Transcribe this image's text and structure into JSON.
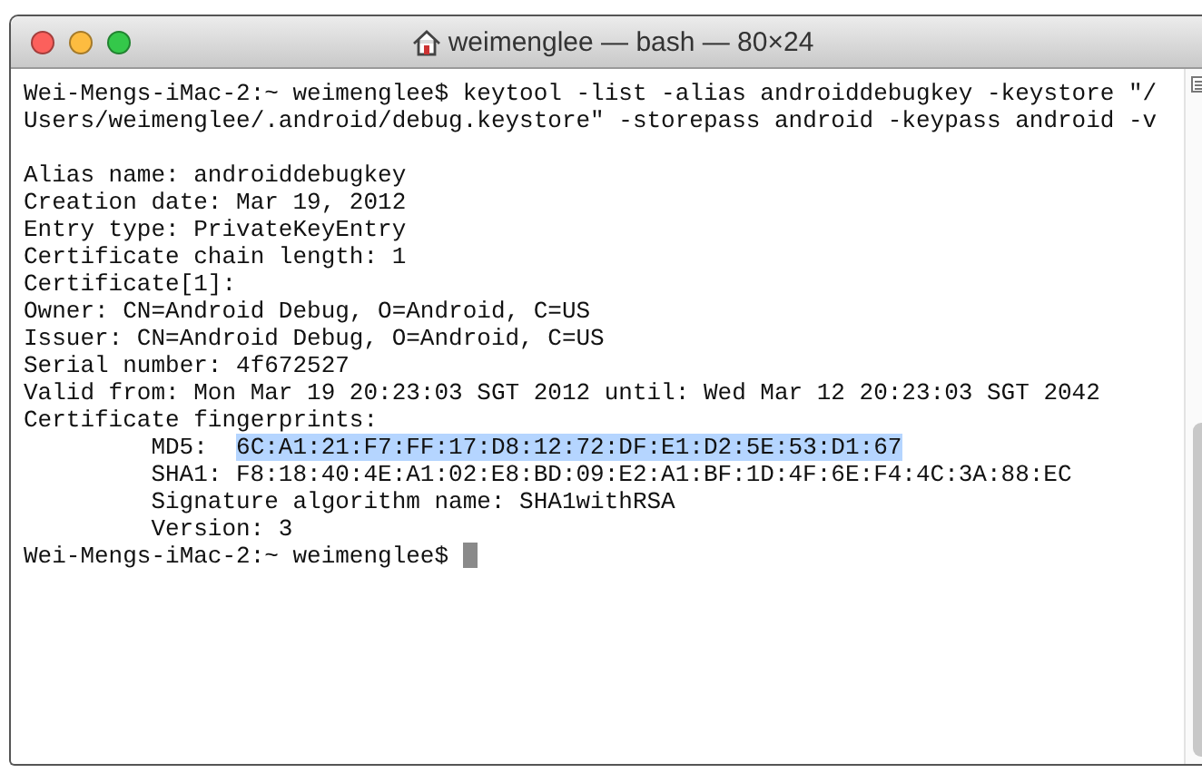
{
  "window": {
    "title": "weimenglee — bash — 80×24"
  },
  "command": [
    "Wei-Mengs-iMac-2:~ weimenglee$ keytool -list -alias androiddebugkey -keystore \"/",
    "Users/weimenglee/.android/debug.keystore\" -storepass android -keypass android -v"
  ],
  "output": [
    {
      "text": "Alias name: androiddebugkey"
    },
    {
      "text": "Creation date: Mar 19, 2012"
    },
    {
      "text": "Entry type: PrivateKeyEntry"
    },
    {
      "text": "Certificate chain length: 1"
    },
    {
      "text": "Certificate[1]:"
    },
    {
      "text": "Owner: CN=Android Debug, O=Android, C=US"
    },
    {
      "text": "Issuer: CN=Android Debug, O=Android, C=US"
    },
    {
      "text": "Serial number: 4f672527"
    },
    {
      "text": "Valid from: Mon Mar 19 20:23:03 SGT 2012 until: Wed Mar 12 20:23:03 SGT 2042"
    },
    {
      "text": "Certificate fingerprints:",
      "children": [
        {
          "text": "MD5:",
          "value": "6C:A1:21:F7:FF:17:D8:12:72:DF:E1:D2:5E:53:D1:67",
          "selected": true
        },
        {
          "text": "SHA1: F8:18:40:4E:A1:02:E8:BD:09:E2:A1:BF:1D:4F:6E:F4:4C:3A:88:EC"
        },
        {
          "text": "Signature algorithm name: SHA1withRSA"
        },
        {
          "text": "Version: 3"
        }
      ]
    }
  ],
  "prompt": {
    "text": "Wei-Mengs-iMac-2:~ weimenglee$",
    "cursor": true
  }
}
